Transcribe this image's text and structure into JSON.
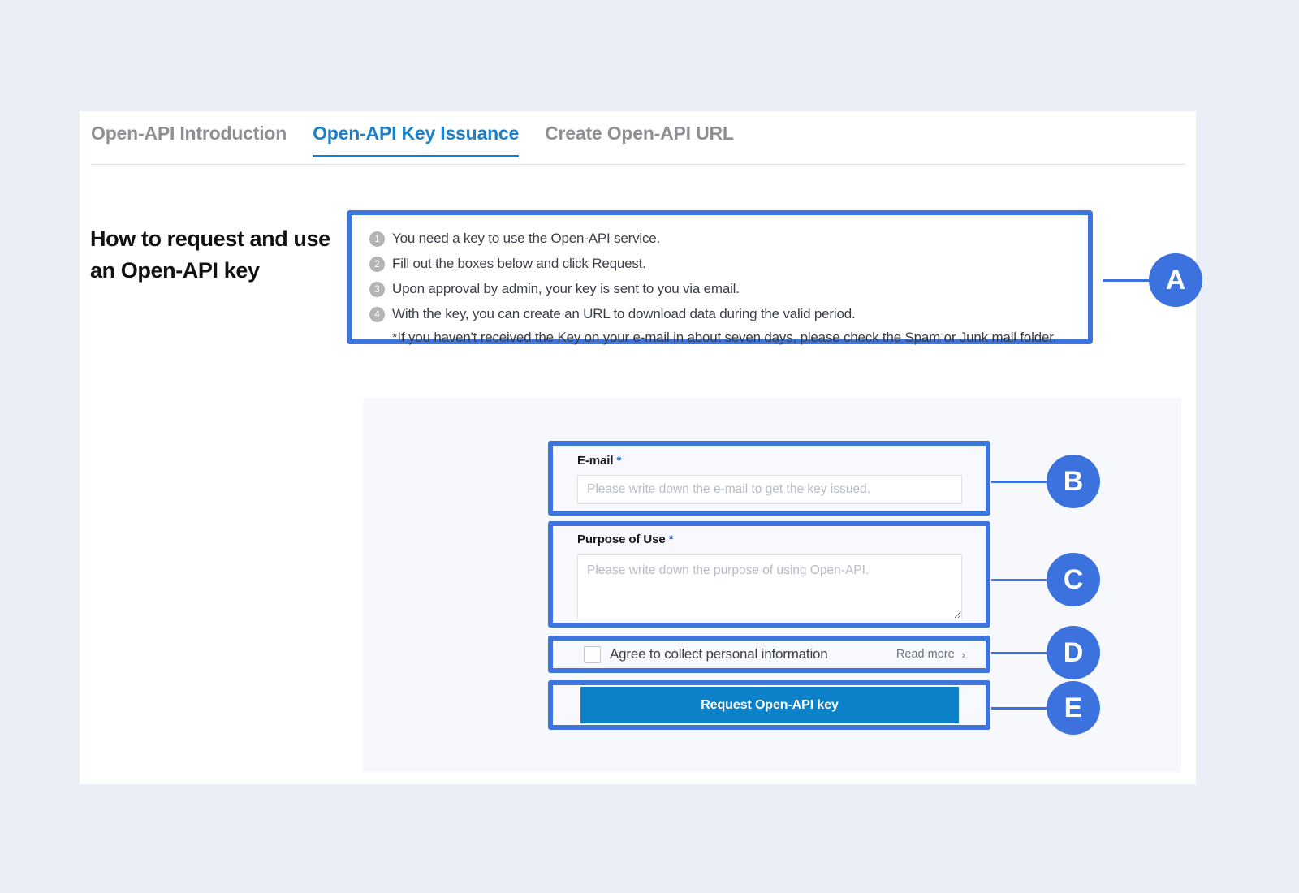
{
  "tabs": [
    {
      "label": "Open-API Introduction",
      "active": false
    },
    {
      "label": "Open-API Key Issuance",
      "active": true
    },
    {
      "label": "Create Open-API URL",
      "active": false
    }
  ],
  "page_title": "How to request and use an Open-API key",
  "instructions": {
    "steps": [
      {
        "num": "1",
        "text": "You need a key to use the Open-API service."
      },
      {
        "num": "2",
        "text": "Fill out the boxes below and click Request."
      },
      {
        "num": "3",
        "text": "Upon approval by admin, your key is sent to you via email."
      },
      {
        "num": "4",
        "text": "With the key, you can create an URL to download data during the valid period."
      }
    ],
    "note": "*If you haven't received the Key on your e-mail in about seven days, please check the Spam or Junk mail folder."
  },
  "form": {
    "email": {
      "label": "E-mail",
      "required_mark": "*",
      "placeholder": "Please write down the e-mail to get the key issued.",
      "value": ""
    },
    "purpose": {
      "label": "Purpose of Use",
      "required_mark": "*",
      "placeholder": "Please write down the purpose of using Open-API.",
      "value": ""
    },
    "agree": {
      "label": "Agree to collect personal information",
      "checked": false,
      "read_more_label": "Read more",
      "read_more_icon": "chevron-right-icon",
      "read_more_glyph": "›"
    },
    "submit": {
      "label": "Request Open-API key"
    }
  },
  "callouts": [
    {
      "id": "A",
      "letter": "A",
      "target": "instructions-box"
    },
    {
      "id": "B",
      "letter": "B",
      "target": "email-field"
    },
    {
      "id": "C",
      "letter": "C",
      "target": "purpose-field"
    },
    {
      "id": "D",
      "letter": "D",
      "target": "agree-row"
    },
    {
      "id": "E",
      "letter": "E",
      "target": "submit-button"
    }
  ],
  "colors": {
    "page_background": "#eaeef7",
    "card_background": "#ffffff",
    "panel_background": "#f7f8fb",
    "accent_blue": "#1c80c8",
    "callout_blue": "#3b72dd",
    "button_blue": "#0c80c8",
    "tab_inactive": "#8d8f94",
    "step_bullet_gray": "#b3b4b8"
  }
}
